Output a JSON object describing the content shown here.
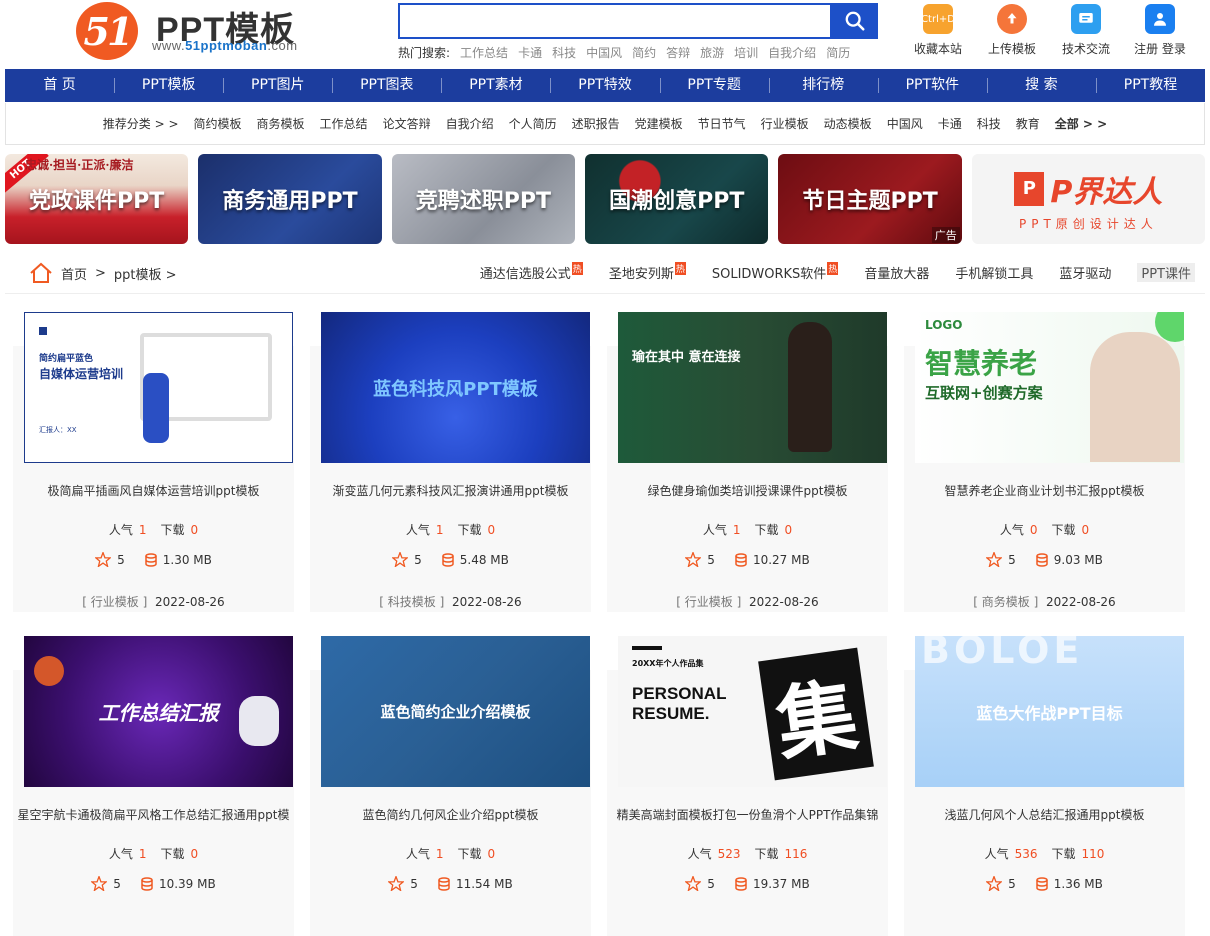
{
  "logo": {
    "number": "51",
    "title": "PPT模板",
    "url_prefix": "www.",
    "url_brand": "51pptmoban",
    "url_suffix": ".com"
  },
  "search": {
    "placeholder": "",
    "value": ""
  },
  "hot": {
    "label": "热门搜索:",
    "keywords": [
      "工作总结",
      "卡通",
      "科技",
      "中国风",
      "简约",
      "答辩",
      "旅游",
      "培训",
      "自我介绍",
      "简历"
    ]
  },
  "tools": [
    {
      "label": "收藏本站",
      "icon": "ctrl-d-icon",
      "badge": "Ctrl+D",
      "color": "#f7a32e"
    },
    {
      "label": "上传模板",
      "icon": "upload-icon",
      "color": "#f5753a"
    },
    {
      "label": "技术交流",
      "icon": "chat-icon",
      "color": "#2d9ff0"
    },
    {
      "label": "注册 登录",
      "icon": "user-icon",
      "color": "#1a7ff0"
    }
  ],
  "nav": [
    "首 页",
    "PPT模板",
    "PPT图片",
    "PPT图表",
    "PPT素材",
    "PPT特效",
    "PPT专题",
    "排行榜",
    "PPT软件",
    "搜 索",
    "PPT教程"
  ],
  "subnav": {
    "label": "推荐分类 > >",
    "items": [
      "简约模板",
      "商务模板",
      "工作总结",
      "论文答辩",
      "自我介绍",
      "个人简历",
      "述职报告",
      "党建模板",
      "节日节气",
      "行业模板",
      "动态模板",
      "中国风",
      "卡通",
      "科技",
      "教育"
    ],
    "all": "全部 > >"
  },
  "banners": [
    {
      "text": "党政课件PPT",
      "hot": "HOT",
      "top": "忠诚·担当·正派·廉洁"
    },
    {
      "text": "商务通用PPT"
    },
    {
      "text": "竞聘述职PPT"
    },
    {
      "text": "国潮创意PPT"
    },
    {
      "text": "节日主题PPT",
      "ad": "广告"
    },
    {
      "logo_box": "P",
      "logo": "P界达人",
      "sub": "PPT原创设计达人"
    }
  ],
  "breadcrumb": {
    "home": "首页",
    "sep": " > ",
    "current": "ppt模板 >"
  },
  "links": [
    {
      "text": "通达信选股公式",
      "hot": "热"
    },
    {
      "text": "圣地安列斯",
      "hot": "热"
    },
    {
      "text": "SOLIDWORKS软件",
      "hot": "热"
    },
    {
      "text": "音量放大器"
    },
    {
      "text": "手机解锁工具"
    },
    {
      "text": "蓝牙驱动"
    },
    {
      "text": "PPT课件"
    }
  ],
  "labels": {
    "popularity": "人气",
    "downloads": "下载"
  },
  "cards": [
    {
      "title": "极简扁平插画风自媒体运营培训ppt模板",
      "pop": "1",
      "dl": "0",
      "rating": "5",
      "size": "1.30 MB",
      "cat": "行业模板",
      "date": "2022-08-26",
      "thumb_main": "自媒体运营培训",
      "thumb_sub": "简约扁平蓝色",
      "thumb_by": "汇报人：XX"
    },
    {
      "title": "渐变蓝几何元素科技风汇报演讲通用ppt模板",
      "pop": "1",
      "dl": "0",
      "rating": "5",
      "size": "5.48 MB",
      "cat": "科技模板",
      "date": "2022-08-26",
      "thumb_main": "蓝色科技风PPT模板"
    },
    {
      "title": "绿色健身瑜伽类培训授课课件ppt模板",
      "pop": "1",
      "dl": "0",
      "rating": "5",
      "size": "10.27 MB",
      "cat": "行业模板",
      "date": "2022-08-26",
      "thumb_main": "瑜在其中 意在连接"
    },
    {
      "title": "智慧养老企业商业计划书汇报ppt模板",
      "pop": "0",
      "dl": "0",
      "rating": "5",
      "size": "9.03 MB",
      "cat": "商务模板",
      "date": "2022-08-26",
      "thumb_logo": "LOGO",
      "thumb_main": "智慧养老",
      "thumb_sub": "互联网+创赛方案"
    },
    {
      "title": "星空宇航卡通极简扁平风格工作总结汇报通用ppt模",
      "pop": "1",
      "dl": "0",
      "rating": "5",
      "size": "10.39 MB",
      "cat": "",
      "date": "",
      "thumb_main": "工作总结汇报"
    },
    {
      "title": "蓝色简约几何风企业介绍ppt模板",
      "pop": "1",
      "dl": "0",
      "rating": "5",
      "size": "11.54 MB",
      "cat": "",
      "date": "",
      "thumb_main": "蓝色简约企业介绍模板"
    },
    {
      "title": "精美高端封面模板打包一份鱼滑个人PPT作品集锦",
      "pop": "523",
      "dl": "116",
      "rating": "5",
      "size": "19.37 MB",
      "cat": "",
      "date": "",
      "thumb_main": "PERSONAL RESUME.",
      "thumb_char": "集",
      "thumb_sub": "20XX年个人作品集"
    },
    {
      "title": "浅蓝几何风个人总结汇报通用ppt模板",
      "pop": "536",
      "dl": "110",
      "rating": "5",
      "size": "1.36 MB",
      "cat": "",
      "date": "",
      "thumb_main": "蓝色大作战PPT目标",
      "thumb_bg": "BOLOE"
    }
  ]
}
